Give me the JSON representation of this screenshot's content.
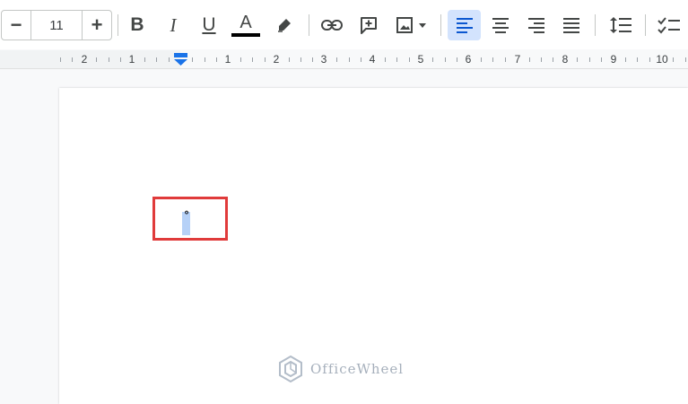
{
  "toolbar": {
    "font_size": {
      "minus_label": "−",
      "value": "11",
      "plus_label": "+"
    },
    "bold_label": "B",
    "italic_label": "I",
    "underline_label": "U",
    "text_color_label": "A",
    "text_color_value": "#000000",
    "accent_color": "#0b57d0"
  },
  "ruler": {
    "labels": [
      "2",
      "1",
      "1",
      "2",
      "3",
      "4",
      "5",
      "6",
      "7",
      "8",
      "9",
      "10"
    ]
  },
  "document": {
    "selected_text": "°"
  },
  "watermark": {
    "text": "OfficeWheel"
  },
  "highlight_color": "#e03b3b"
}
